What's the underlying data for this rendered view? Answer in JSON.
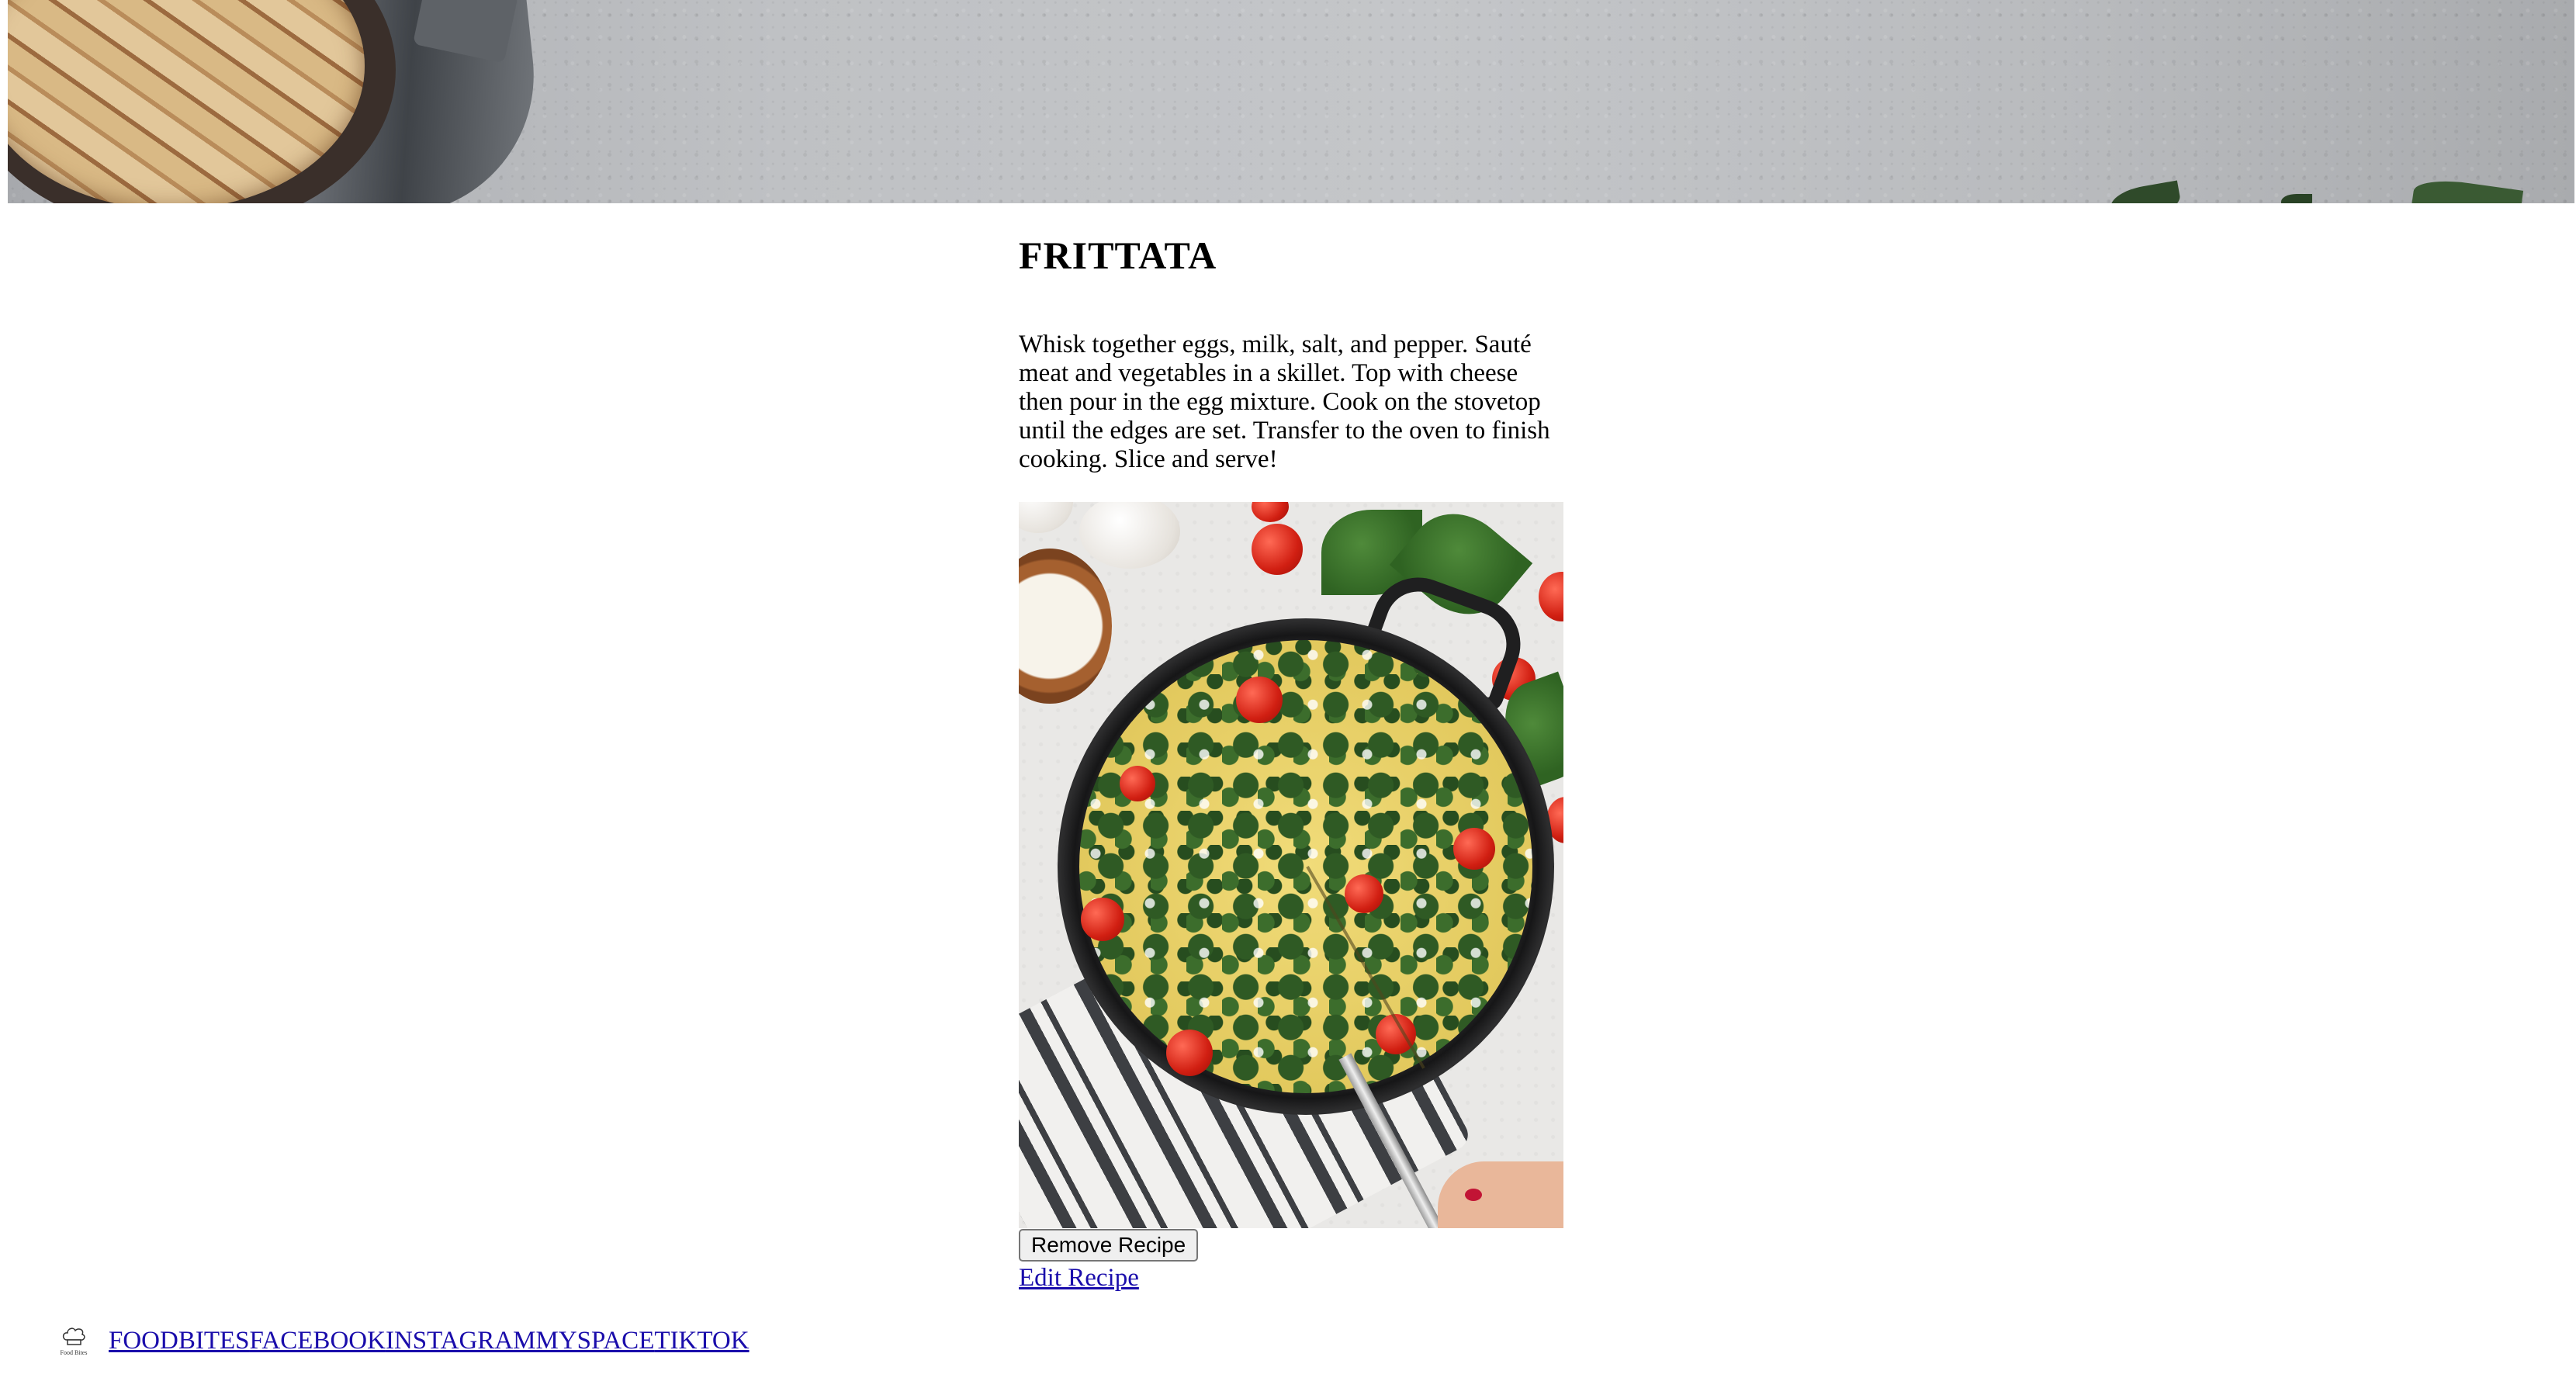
{
  "recipe": {
    "title": "FRITTATA",
    "instructions": "Whisk together eggs, milk, salt, and pepper. Sauté meat and vegetables in a skillet. Top with cheese then pour in the egg mixture. Cook on the stovetop until the edges are set. Transfer to the oven to finish cooking. Slice and serve!",
    "image_alt": "frittata-photo",
    "remove_label": "Remove Recipe",
    "edit_label": "Edit Recipe"
  },
  "footer": {
    "logo_text": "Food Bites",
    "links": [
      {
        "label": "FOODBITES"
      },
      {
        "label": "FACEBOOK"
      },
      {
        "label": "INSTAGRAM"
      },
      {
        "label": "MYSPACE"
      },
      {
        "label": "TIKTOK"
      }
    ]
  },
  "colors": {
    "link": "#1a0dab",
    "button_bg": "#efefef",
    "button_border": "#767676"
  }
}
